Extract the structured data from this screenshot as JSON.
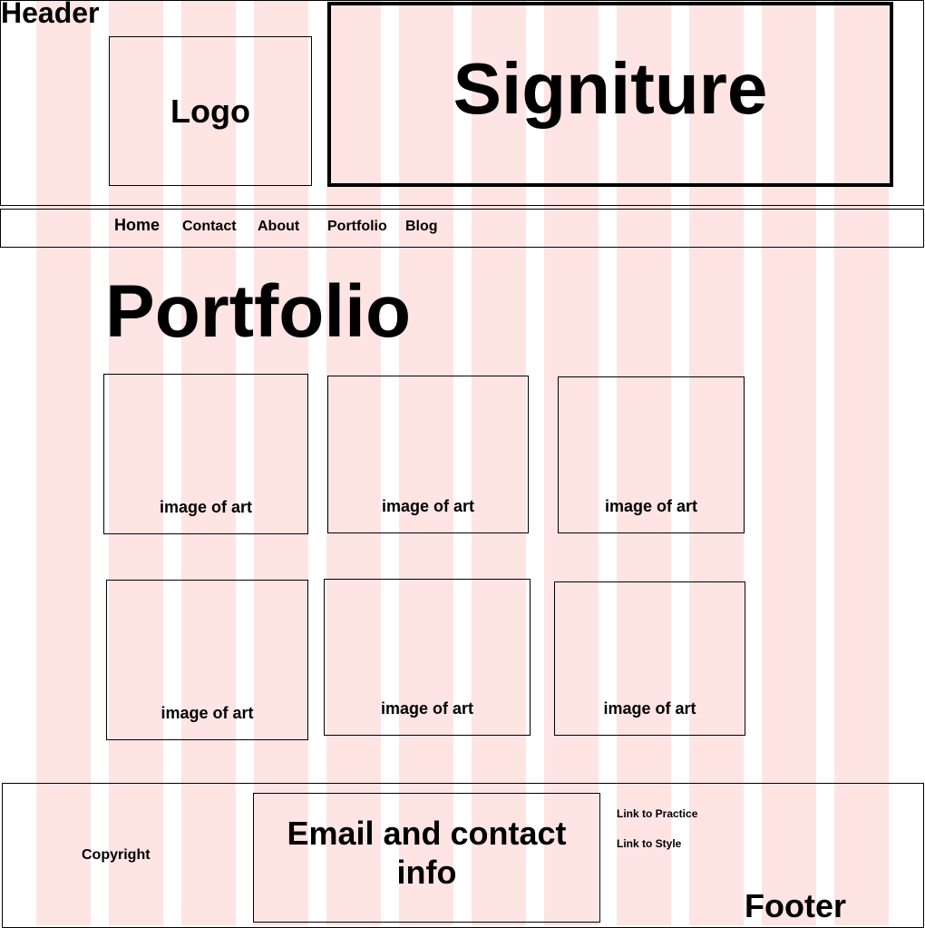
{
  "header": {
    "label": "Header",
    "logo": "Logo",
    "signature": "Signiture"
  },
  "nav": {
    "home": "Home",
    "contact": "Contact",
    "about": "About",
    "portfolio": "Portfolio",
    "blog": "Blog"
  },
  "main": {
    "title": "Portfolio",
    "art_items": [
      "image of art",
      "image of art",
      "image of art",
      "image of art",
      "image of art",
      "image of art"
    ]
  },
  "footer": {
    "label": "Footer",
    "copyright": "Copyright",
    "email": "Email and contact info",
    "links": [
      "Link to Practice",
      "Link to Style"
    ]
  },
  "colors": {
    "grid_column": "#ffe4e4",
    "border": "#000000",
    "background": "#ffffff"
  }
}
